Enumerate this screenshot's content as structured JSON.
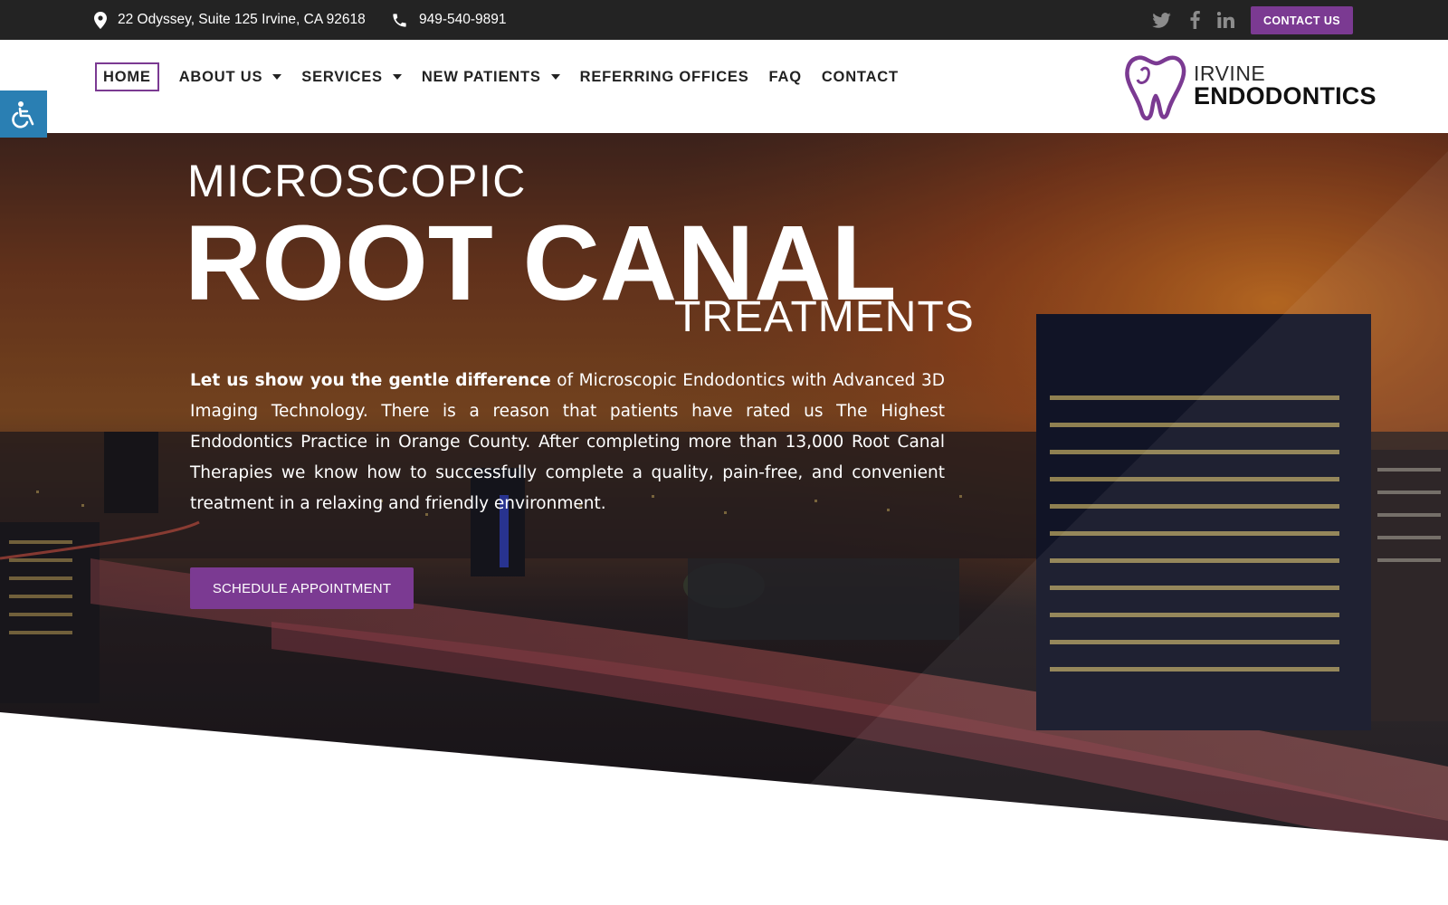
{
  "topbar": {
    "address": "22 Odyssey, Suite 125 Irvine, CA 92618",
    "address_icon": "map-pin-icon",
    "phone": "949-540-9891",
    "phone_icon": "phone-icon",
    "social_icons": [
      "twitter-icon",
      "facebook-icon",
      "linkedin-icon"
    ],
    "contact_button": "CONTACT US"
  },
  "nav": {
    "items": [
      {
        "label": "HOME",
        "active": true,
        "has_dropdown": false
      },
      {
        "label": "ABOUT US",
        "active": false,
        "has_dropdown": true
      },
      {
        "label": "SERVICES",
        "active": false,
        "has_dropdown": true
      },
      {
        "label": "NEW PATIENTS",
        "active": false,
        "has_dropdown": true
      },
      {
        "label": "REFERRING OFFICES",
        "active": false,
        "has_dropdown": false
      },
      {
        "label": "FAQ",
        "active": false,
        "has_dropdown": false
      },
      {
        "label": "CONTACT",
        "active": false,
        "has_dropdown": false
      }
    ]
  },
  "logo": {
    "line1": "IRVINE",
    "line2": "ENDODONTICS",
    "icon": "tooth-heart-logo-icon"
  },
  "accessibility": {
    "icon": "wheelchair-accessibility-icon"
  },
  "hero": {
    "heading_top": "MICROSCOPIC",
    "heading_main": "ROOT CANAL",
    "heading_bottom": "TREATMENTS",
    "intro_bold": "Let us show you the gentle difference",
    "intro_rest": " of Microscopic Endodontics with Advanced 3D Imaging Technology. There is a reason that patients have rated us The Highest Endodontics Practice in Orange County. After completing more than 13,000 Root Canal Therapies we know how to successfully complete a quality, pain-free, and convenient treatment in a relaxing and friendly environment.",
    "cta_label": "SCHEDULE APPOINTMENT"
  },
  "colors": {
    "brand_purple": "#7b3a92",
    "topbar_bg": "#232323",
    "accessibility_blue": "#2a7fb3"
  }
}
